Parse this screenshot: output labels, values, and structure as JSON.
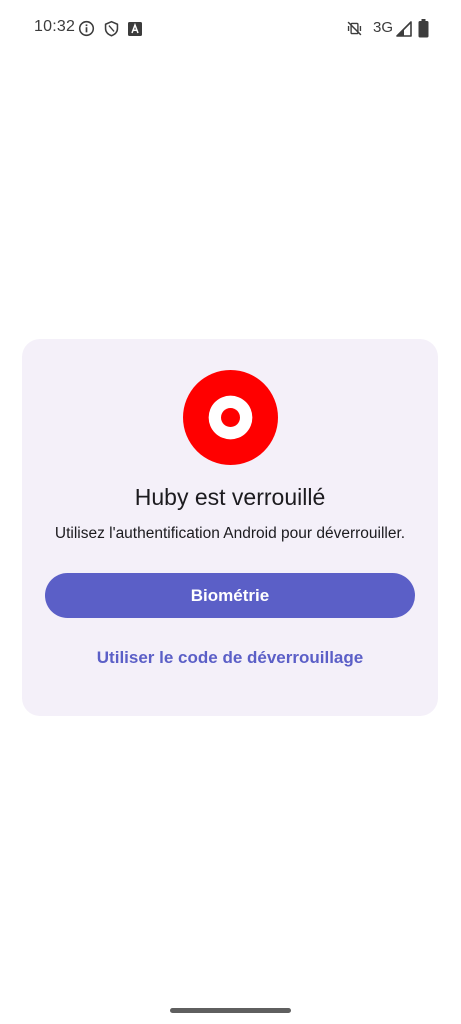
{
  "status_bar": {
    "time": "10:32",
    "network": "3G",
    "icons": [
      "info-icon",
      "shield-icon",
      "keyboard-a-icon",
      "vibrate-mute-icon",
      "signal-icon",
      "battery-icon"
    ]
  },
  "lock_screen": {
    "logo_icon": "target-logo-icon",
    "logo_color": "#ff0000",
    "title": "Huby est verrouillé",
    "subtitle": "Utilisez l'authentification Android pour déverrouiller.",
    "biometric_button_label": "Biométrie",
    "unlock_code_link_label": "Utiliser le code de déverrouillage",
    "accent_color": "#5b5fc7",
    "card_color": "#f4f0f9"
  }
}
